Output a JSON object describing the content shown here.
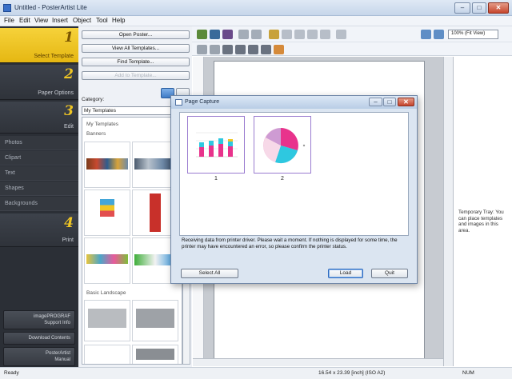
{
  "window": {
    "title": "Untitled - PosterArtist Lite",
    "minimize": "–",
    "maximize": "□",
    "close": "✕"
  },
  "menu": [
    "File",
    "Edit",
    "View",
    "Insert",
    "Object",
    "Tool",
    "Help"
  ],
  "steps": [
    {
      "num": "1",
      "label": "Select Template",
      "active": true
    },
    {
      "num": "2",
      "label": "Paper Options"
    },
    {
      "num": "3",
      "label": "Edit"
    },
    {
      "num": "4",
      "label": "Print"
    }
  ],
  "edit_items": [
    "Photos",
    "Clipart",
    "Text",
    "Shapes",
    "Backgrounds"
  ],
  "left_buttons": [
    {
      "line1": "imagePROGRAF",
      "line2": "Support Info"
    },
    {
      "line1": "Download Contents",
      "line2": ""
    },
    {
      "line1": "PosterArtist",
      "line2": "Manual"
    }
  ],
  "template_buttons": [
    "Open Poster...",
    "View All Templates...",
    "Find Template...",
    "Add to Template..."
  ],
  "category": {
    "label": "Category:",
    "value": "My Templates"
  },
  "template_list": {
    "group": "My Templates",
    "sub1": "Banners",
    "sub2": "Basic Landscape"
  },
  "zoom": "100% (Fit View)",
  "tray_text": "Temporary Tray: You can place templates and images in this area.",
  "status": {
    "left": "Ready",
    "size": "16.54 x 23.39 [inch] (ISO A2)",
    "mode": "NUM"
  },
  "dialog": {
    "title": "Page Capture",
    "pages": [
      "1",
      "2"
    ],
    "message": "Receiving data from printer driver. Please wait a moment. If nothing is displayed for some time, the printer may have encountered an error, so please confirm the printer status.",
    "select_all": "Select All",
    "load": "Load",
    "quit": "Quit"
  },
  "colors": {
    "accent_yellow": "#f0c624",
    "panel_dark": "#2b2f36",
    "pie_pink": "#e8338c",
    "pie_cyan": "#2ec8e0",
    "pie_purple": "#8a4fc7"
  }
}
